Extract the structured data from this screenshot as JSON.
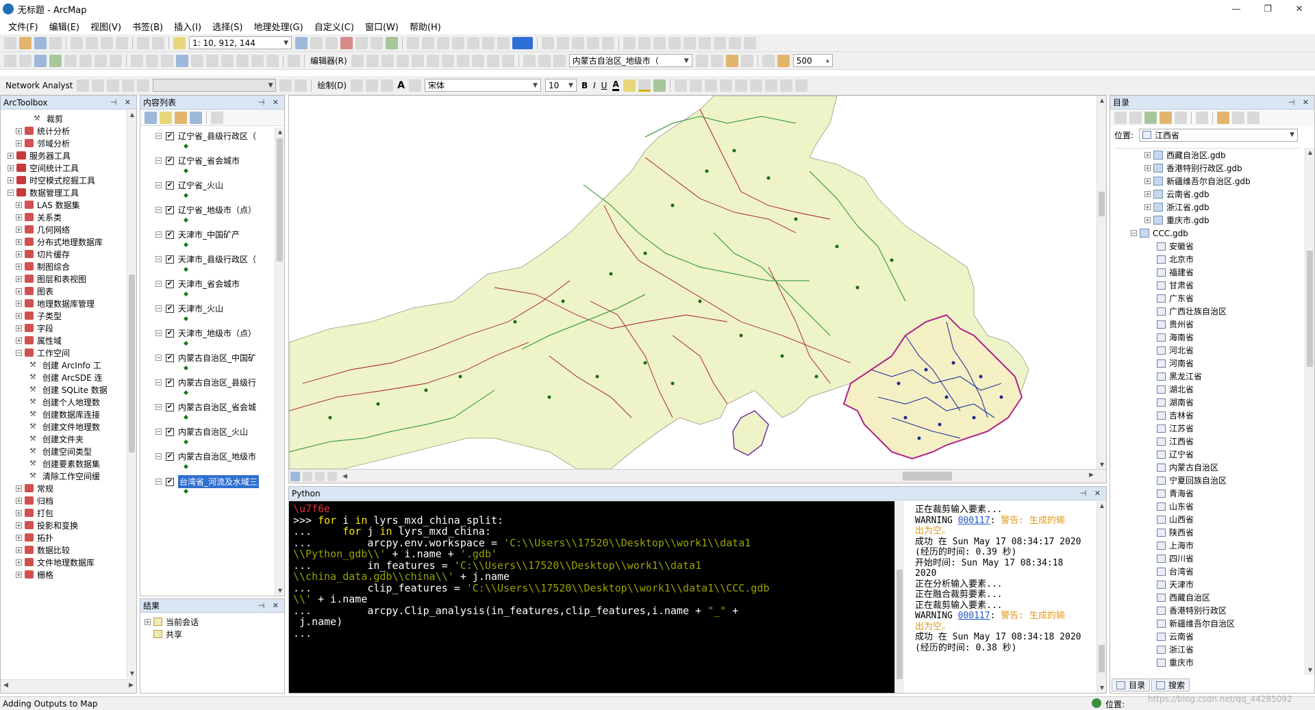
{
  "window": {
    "title": "无标题 - ArcMap",
    "controls": [
      "—",
      "❐",
      "✕"
    ]
  },
  "menu": [
    "文件(F)",
    "编辑(E)",
    "视图(V)",
    "书签(B)",
    "插入(I)",
    "选择(S)",
    "地理处理(G)",
    "自定义(C)",
    "窗口(W)",
    "帮助(H)"
  ],
  "toolbars": {
    "scale": "1: 10, 912, 144",
    "editor_label": "编辑器(R)",
    "layer_combo": "内蒙古自治区_地级市（",
    "zoom_value": "500",
    "network_analyst": "Network Analyst",
    "drawing_label": "绘制(D)",
    "font_name": "宋体",
    "font_size": "10",
    "bold": "B",
    "italic": "I",
    "underline": "U",
    "font_color": "A"
  },
  "arctoolbox": {
    "title": "ArcToolbox",
    "items": [
      {
        "label": "裁剪",
        "level": 3,
        "type": "tool"
      },
      {
        "label": "统计分析",
        "level": 1,
        "type": "toolset"
      },
      {
        "label": "邻域分析",
        "level": 1,
        "type": "toolset"
      },
      {
        "label": "服务器工具",
        "level": 0,
        "type": "toolbox"
      },
      {
        "label": "空间统计工具",
        "level": 0,
        "type": "toolbox"
      },
      {
        "label": "时空模式挖掘工具",
        "level": 0,
        "type": "toolbox"
      },
      {
        "label": "数据管理工具",
        "level": 0,
        "type": "toolbox",
        "expanded": true
      },
      {
        "label": "LAS 数据集",
        "level": 1,
        "type": "toolset"
      },
      {
        "label": "关系类",
        "level": 1,
        "type": "toolset"
      },
      {
        "label": "几何网络",
        "level": 1,
        "type": "toolset"
      },
      {
        "label": "分布式地理数据库",
        "level": 1,
        "type": "toolset"
      },
      {
        "label": "切片缓存",
        "level": 1,
        "type": "toolset"
      },
      {
        "label": "制图综合",
        "level": 1,
        "type": "toolset"
      },
      {
        "label": "图层和表视图",
        "level": 1,
        "type": "toolset"
      },
      {
        "label": "图表",
        "level": 1,
        "type": "toolset"
      },
      {
        "label": "地理数据库管理",
        "level": 1,
        "type": "toolset"
      },
      {
        "label": "子类型",
        "level": 1,
        "type": "toolset"
      },
      {
        "label": "字段",
        "level": 1,
        "type": "toolset"
      },
      {
        "label": "属性域",
        "level": 1,
        "type": "toolset"
      },
      {
        "label": "工作空间",
        "level": 1,
        "type": "toolset",
        "expanded": true
      },
      {
        "label": "创建 ArcInfo 工",
        "level": 2,
        "type": "tool"
      },
      {
        "label": "创建 ArcSDE 连",
        "level": 2,
        "type": "tool"
      },
      {
        "label": "创建 SQLite 数据",
        "level": 2,
        "type": "tool"
      },
      {
        "label": "创建个人地理数",
        "level": 2,
        "type": "tool"
      },
      {
        "label": "创建数据库连接",
        "level": 2,
        "type": "tool"
      },
      {
        "label": "创建文件地理数",
        "level": 2,
        "type": "tool"
      },
      {
        "label": "创建文件夹",
        "level": 2,
        "type": "tool"
      },
      {
        "label": "创建空间类型",
        "level": 2,
        "type": "tool"
      },
      {
        "label": "创建要素数据集",
        "level": 2,
        "type": "tool"
      },
      {
        "label": "清除工作空间缓",
        "level": 2,
        "type": "tool"
      },
      {
        "label": "常规",
        "level": 1,
        "type": "toolset"
      },
      {
        "label": "归档",
        "level": 1,
        "type": "toolset"
      },
      {
        "label": "打包",
        "level": 1,
        "type": "toolset"
      },
      {
        "label": "投影和变换",
        "level": 1,
        "type": "toolset"
      },
      {
        "label": "拓扑",
        "level": 1,
        "type": "toolset"
      },
      {
        "label": "数据比较",
        "level": 1,
        "type": "toolset"
      },
      {
        "label": "文件地理数据库",
        "level": 1,
        "type": "toolset"
      },
      {
        "label": "栅格",
        "level": 1,
        "type": "toolset"
      }
    ]
  },
  "toc": {
    "title": "内容列表",
    "layers": [
      "辽宁省_县级行政区（",
      "辽宁省_省会城市",
      "辽宁省_火山",
      "辽宁省_地级市（点）",
      "天津市_中国矿产",
      "天津市_县级行政区（",
      "天津市_省会城市",
      "天津市_火山",
      "天津市_地级市（点）",
      "内蒙古自治区_中国矿",
      "内蒙古自治区_县级行",
      "内蒙古自治区_省会城",
      "内蒙古自治区_火山",
      "内蒙古自治区_地级市",
      "台湾省_河流及水域三"
    ]
  },
  "results": {
    "title": "结果",
    "items": [
      "当前会话",
      "共享"
    ]
  },
  "catalog": {
    "title": "目录",
    "location_label": "位置:",
    "location_value": "江西省",
    "tree": [
      {
        "label": "西藏自治区.gdb",
        "kind": "gdb"
      },
      {
        "label": "香港特别行政区.gdb",
        "kind": "gdb"
      },
      {
        "label": "新疆维吾尔自治区.gdb",
        "kind": "gdb"
      },
      {
        "label": "云南省.gdb",
        "kind": "gdb"
      },
      {
        "label": "浙江省.gdb",
        "kind": "gdb"
      },
      {
        "label": "重庆市.gdb",
        "kind": "gdb"
      },
      {
        "label": "CCC.gdb",
        "kind": "gdb-open"
      },
      {
        "label": "安徽省",
        "kind": "fc"
      },
      {
        "label": "北京市",
        "kind": "fc"
      },
      {
        "label": "福建省",
        "kind": "fc"
      },
      {
        "label": "甘肃省",
        "kind": "fc"
      },
      {
        "label": "广东省",
        "kind": "fc"
      },
      {
        "label": "广西壮族自治区",
        "kind": "fc"
      },
      {
        "label": "贵州省",
        "kind": "fc"
      },
      {
        "label": "海南省",
        "kind": "fc"
      },
      {
        "label": "河北省",
        "kind": "fc"
      },
      {
        "label": "河南省",
        "kind": "fc"
      },
      {
        "label": "黑龙江省",
        "kind": "fc"
      },
      {
        "label": "湖北省",
        "kind": "fc"
      },
      {
        "label": "湖南省",
        "kind": "fc"
      },
      {
        "label": "吉林省",
        "kind": "fc"
      },
      {
        "label": "江苏省",
        "kind": "fc"
      },
      {
        "label": "江西省",
        "kind": "fc"
      },
      {
        "label": "辽宁省",
        "kind": "fc"
      },
      {
        "label": "内蒙古自治区",
        "kind": "fc"
      },
      {
        "label": "宁夏回族自治区",
        "kind": "fc"
      },
      {
        "label": "青海省",
        "kind": "fc"
      },
      {
        "label": "山东省",
        "kind": "fc"
      },
      {
        "label": "山西省",
        "kind": "fc"
      },
      {
        "label": "陕西省",
        "kind": "fc"
      },
      {
        "label": "上海市",
        "kind": "fc"
      },
      {
        "label": "四川省",
        "kind": "fc"
      },
      {
        "label": "台湾省",
        "kind": "fc"
      },
      {
        "label": "天津市",
        "kind": "fc"
      },
      {
        "label": "西藏自治区",
        "kind": "fc"
      },
      {
        "label": "香港特别行政区",
        "kind": "fc"
      },
      {
        "label": "新疆维吾尔自治区",
        "kind": "fc"
      },
      {
        "label": "云南省",
        "kind": "fc"
      },
      {
        "label": "浙江省",
        "kind": "fc"
      },
      {
        "label": "重庆市",
        "kind": "fc"
      }
    ],
    "tabs": [
      "目录",
      "搜索"
    ]
  },
  "python": {
    "title": "Python",
    "lines": [
      [
        {
          "t": "\\u7f6e",
          "c": "err"
        }
      ],
      [
        {
          "t": ">>> "
        },
        {
          "t": "for",
          "c": "kw"
        },
        {
          "t": " i "
        },
        {
          "t": "in",
          "c": "kw"
        },
        {
          "t": " lyrs_mxd_china_split:"
        }
      ],
      [
        {
          "t": "...     "
        },
        {
          "t": "for",
          "c": "kw"
        },
        {
          "t": " j "
        },
        {
          "t": "in",
          "c": "kw"
        },
        {
          "t": " lyrs_mxd_china:"
        }
      ],
      [
        {
          "t": "...         arcpy.env.workspace = "
        },
        {
          "t": "'C:\\\\Users\\\\17520\\\\Desktop\\\\work1\\\\data1",
          "c": "str"
        }
      ],
      [
        {
          "t": "\\\\Python_gdb\\\\'",
          "c": "str"
        },
        {
          "t": " + i.name + "
        },
        {
          "t": "'.gdb'",
          "c": "str"
        }
      ],
      [
        {
          "t": "...         in_features = "
        },
        {
          "t": "'C:\\\\Users\\\\17520\\\\Desktop\\\\work1\\\\data1",
          "c": "str"
        }
      ],
      [
        {
          "t": "\\\\china_data.gdb\\\\china\\\\'",
          "c": "str"
        },
        {
          "t": " + j.name"
        }
      ],
      [
        {
          "t": "...         clip_features = "
        },
        {
          "t": "'C:\\\\Users\\\\17520\\\\Desktop\\\\work1\\\\data1\\\\CCC.gdb",
          "c": "str"
        }
      ],
      [
        {
          "t": "\\\\'",
          "c": "str"
        },
        {
          "t": " + i.name"
        }
      ],
      [
        {
          "t": "...         arcpy.Clip_analysis(in_features,clip_features,i.name + "
        },
        {
          "t": "\"_\"",
          "c": "str"
        },
        {
          "t": " +"
        }
      ],
      [
        {
          "t": " j.name)"
        }
      ],
      [
        {
          "t": "..."
        }
      ]
    ],
    "messages": [
      [
        {
          "t": "正在裁剪输入要素..."
        }
      ],
      [
        {
          "t": "WARNING "
        },
        {
          "t": "000117",
          "c": "lnk"
        },
        {
          "t": ": "
        },
        {
          "t": "警告: 生成的输",
          "c": "warn"
        }
      ],
      [
        {
          "t": "出为空。",
          "c": "warn"
        }
      ],
      [
        {
          "t": "成功 在 Sun May 17 08:34:17 2020"
        }
      ],
      [
        {
          "t": "(经历的时间: 0.39 秒)"
        }
      ],
      [
        {
          "t": "开始时间: Sun May 17 08:34:18"
        }
      ],
      [
        {
          "t": "2020"
        }
      ],
      [
        {
          "t": "正在分析输入要素..."
        }
      ],
      [
        {
          "t": "正在融合裁剪要素..."
        }
      ],
      [
        {
          "t": "正在裁剪输入要素..."
        }
      ],
      [
        {
          "t": "WARNING "
        },
        {
          "t": "000117",
          "c": "lnk"
        },
        {
          "t": ": "
        },
        {
          "t": "警告: 生成的输",
          "c": "warn"
        }
      ],
      [
        {
          "t": "出为空。",
          "c": "warn"
        }
      ],
      [
        {
          "t": "成功 在 Sun May 17 08:34:18 2020"
        }
      ],
      [
        {
          "t": "(经历的时间: 0.38 秒)"
        }
      ]
    ]
  },
  "status": {
    "left": "Adding Outputs to Map",
    "position_label": "位置:",
    "watermark": "https://blog.csdn.net/qq_44285092"
  }
}
